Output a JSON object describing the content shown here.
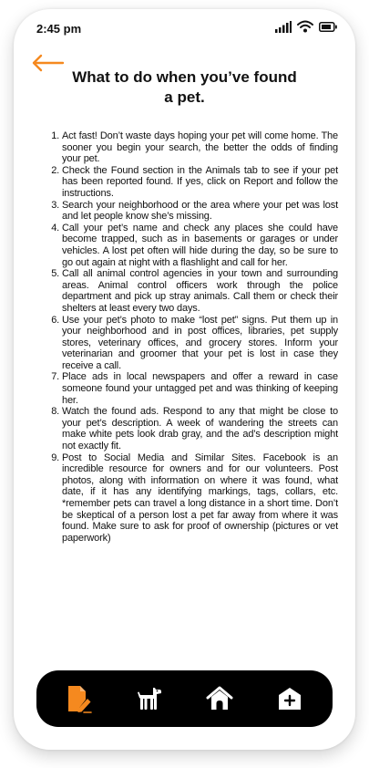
{
  "status_bar": {
    "time": "2:45 pm"
  },
  "header": {
    "back_icon": "arrow-left-icon",
    "title": "What to do when you’ve found a pet."
  },
  "steps": [
    "Act fast! Don’t waste days hoping your pet will come home. The sooner you begin your search, the better the odds of finding your pet.",
    "Check the Found section in the Animals tab to see if your pet has been reported found. If yes, click on Report and follow the instructions.",
    "Search your neighborhood or the area where your pet was lost and let people know she’s missing.",
    "Call your pet’s name and check any places she could have become trapped, such as in basements or garages or under vehicles. A lost pet often will hide during the day, so be sure to go out again at night with a flashlight and call for her.",
    "Call all animal control agencies in your town and surrounding areas. Animal control officers work through the police department and pick up stray animals. Call them or check their shelters at least every two days.",
    " Use your pet’s photo to make “lost pet” signs. Put them up in your neighborhood and in post offices, libraries, pet supply stores, veterinary offices, and grocery stores. Inform your veterinarian and groomer that your pet is lost in case they receive a call.",
    " Place ads in local newspapers and offer a reward in case someone found your untagged pet and was thinking of keeping her.",
    "Watch the found ads. Respond to any that might be close to your pet’s description. A week of wandering the streets can make white pets look drab gray, and the ad’s description might not exactly fit.",
    "Post to Social Media and Similar Sites. Facebook is an incredible resource for owners and for our volunteers. Post photos, along with information on where it was found, what date, if it has any identifying markings, tags, collars, etc. *remember pets can travel a long distance in a short time. Don’t be skeptical of a person lost a pet far away from where it was found. Make sure to ask for proof of ownership (pictures or vet paperwork)"
  ],
  "bottom_nav": {
    "items": [
      {
        "icon": "document-edit-icon",
        "active": true
      },
      {
        "icon": "dog-icon",
        "active": false
      },
      {
        "icon": "home-icon",
        "active": false
      },
      {
        "icon": "shelter-add-icon",
        "active": false
      }
    ]
  },
  "colors": {
    "accent": "#F5891F",
    "nav_background": "#000000",
    "nav_icon": "#FFFFFF",
    "text": "#111111"
  }
}
